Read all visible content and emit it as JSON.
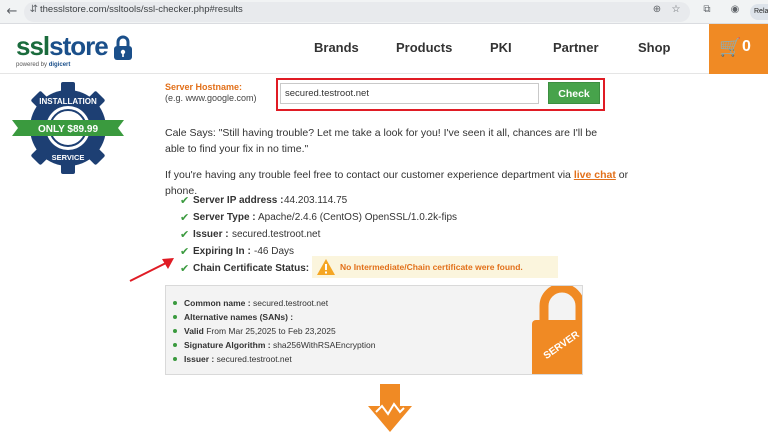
{
  "browser": {
    "url": "thesslstore.com/ssltools/ssl-checker.php#results",
    "relaunch_label": "Relaunch",
    "back_glyph": "←",
    "reload_glyph": "↻",
    "tune_glyph": "⇵",
    "zoom_glyph": "⊕",
    "star_glyph": "☆",
    "extensions_glyph": "⧉",
    "profile_glyph": "◉"
  },
  "header": {
    "logo_ssl": "ssl",
    "logo_store": "store",
    "powered_by": "powered by",
    "powered_brand": "digicert",
    "nav": [
      "Brands",
      "Products",
      "PKI",
      "Partner",
      "Shop"
    ],
    "cart_glyph": "🛒",
    "cart_count": "0"
  },
  "badge": {
    "top": "INSTALLATION",
    "price": "ONLY $89.99",
    "bottom": "SERVICE"
  },
  "form": {
    "label": "Server Hostname:",
    "hint": "(e.g. www.google.com)",
    "input_value": "secured.testroot.net",
    "button": "Check"
  },
  "messages": {
    "cale": "Cale Says: \"Still having trouble? Let me take a look for you! I've seen it all, chances are I'll be able to find your fix in no time.\"",
    "contact_before": "If you're having any trouble feel free to contact our customer experience department via ",
    "contact_link": "live chat",
    "contact_after": " or phone."
  },
  "results": [
    {
      "label": "Server IP address :",
      "value": "44.203.114.75"
    },
    {
      "label": "Server Type :",
      "value": "Apache/2.4.6 (CentOS) OpenSSL/1.0.2k-fips"
    },
    {
      "label": "Issuer :",
      "value": "secured.testroot.net"
    },
    {
      "label": "Expiring In :",
      "value": "-46 Days"
    },
    {
      "label": "Chain Certificate Status:",
      "value": ""
    }
  ],
  "check_glyph": "✔",
  "warning": "No Intermediate/Chain certificate were found.",
  "certificate": {
    "common_name_label": "Common name :",
    "common_name": "secured.testroot.net",
    "alt_names_label": "Alternative names (SANs) :",
    "valid_label": "Valid",
    "valid_value": "From Mar 25,2025 to Feb 23,2025",
    "sig_label": "Signature Algorithm :",
    "sig_value": "sha256WithRSAEncryption",
    "issuer_label": "Issuer :",
    "issuer_value": "secured.testroot.net",
    "lock_text": "SERVER"
  },
  "colors": {
    "accent_orange": "#f08a24",
    "check_green": "#47a34b",
    "highlight_red": "#e01b24"
  }
}
